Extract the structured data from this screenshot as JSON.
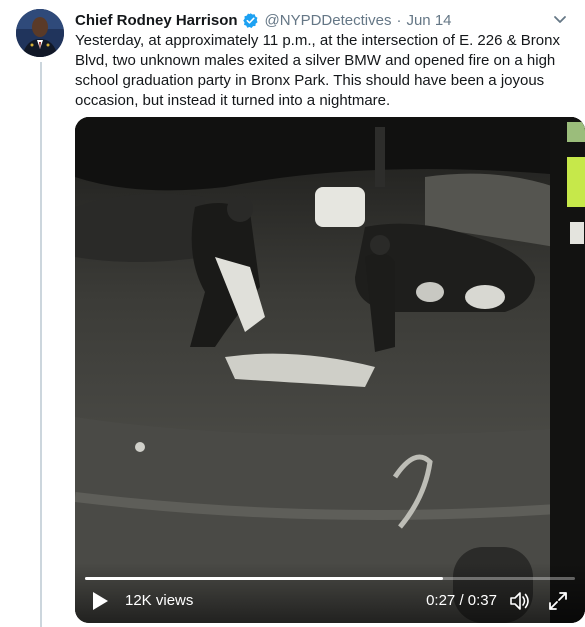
{
  "tweet": {
    "author_name": "Chief Rodney Harrison",
    "handle": "@NYPDDetectives",
    "separator": "·",
    "date": "Jun 14",
    "text": "Yesterday, at approximately 11 p.m., at the intersection of E. 226 & Bronx Blvd, two unknown males exited a silver BMW and opened fire on a high school graduation party in Bronx Park. This should have been a joyous occasion, but instead it turned into a nightmare."
  },
  "video": {
    "views": "12K views",
    "current_time": "0:27",
    "time_separator": " / ",
    "duration": "0:37",
    "progress": 0.73
  },
  "icons": [
    "verified-badge-icon",
    "chevron-down-icon",
    "play-icon",
    "volume-icon",
    "fullscreen-icon"
  ],
  "colors": {
    "verified": "#1da1f2",
    "muted_text": "#657786",
    "text": "#14171a"
  }
}
